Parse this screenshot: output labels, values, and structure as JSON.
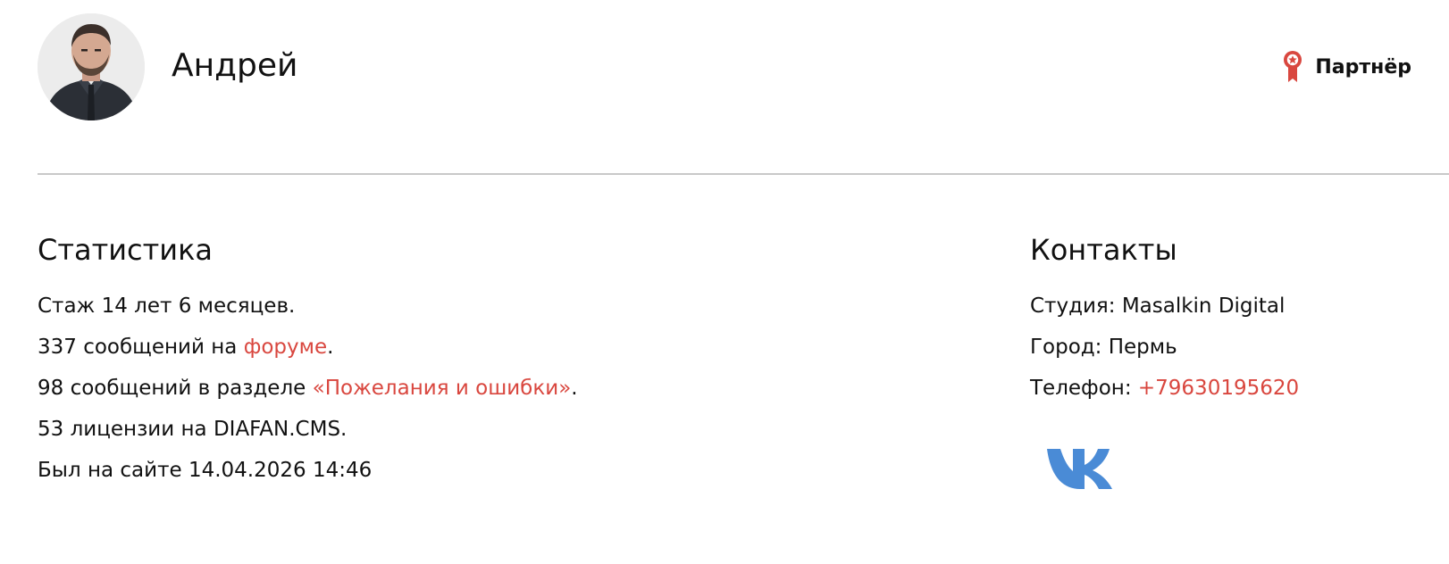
{
  "profile": {
    "name": "Андрей",
    "badge_label": "Партнёр",
    "badge_icon": "award-ribbon-icon",
    "accent_color": "#d9473f"
  },
  "stats": {
    "title": "Статистика",
    "experience": "Стаж 14 лет 6 месяцев.",
    "forum_prefix": "337 сообщений на ",
    "forum_link": "форуме",
    "forum_suffix": ".",
    "wishes_prefix": "98 сообщений в разделе ",
    "wishes_link": "«Пожелания и ошибки»",
    "wishes_suffix": ".",
    "licenses": "53 лицензии на DIAFAN.CMS.",
    "last_seen": "Был на сайте 14.04.2026 14:46"
  },
  "contacts": {
    "title": "Контакты",
    "studio": "Студия: Masalkin Digital",
    "city": "Город: Пермь",
    "phone_label": "Телефон: ",
    "phone": "+79630195620",
    "social_icon": "vk-icon",
    "social_color": "#4a8bd6"
  }
}
